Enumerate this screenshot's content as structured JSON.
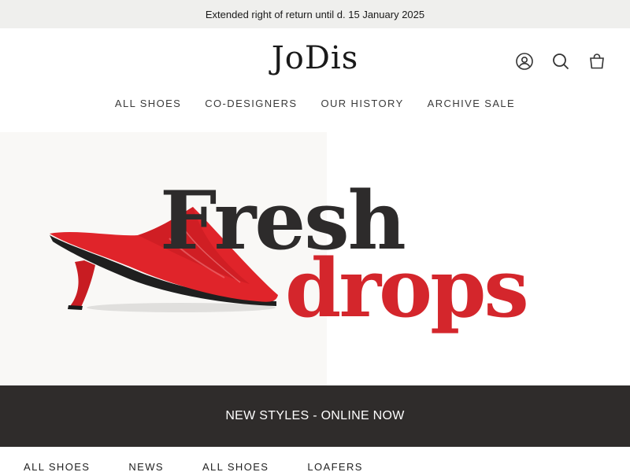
{
  "announcement": {
    "text": "Extended right of return until d. 15 January 2025"
  },
  "header": {
    "logo": "JoDis",
    "icons": [
      "account-icon",
      "search-icon",
      "cart-icon"
    ]
  },
  "main_nav": [
    {
      "label": "ALL SHOES"
    },
    {
      "label": "CO-DESIGNERS"
    },
    {
      "label": "OUR HISTORY"
    },
    {
      "label": "ARCHIVE SALE"
    }
  ],
  "hero": {
    "line1": "Fresh",
    "line2": "drops",
    "accent_color": "#d4262c",
    "dark_color": "#2d2b2b"
  },
  "band": {
    "text": "NEW STYLES - ONLINE NOW"
  },
  "bottom_nav": [
    {
      "label": "ALL SHOES"
    },
    {
      "label": "NEWS"
    },
    {
      "label": "ALL SHOES"
    },
    {
      "label": "LOAFERS"
    }
  ]
}
